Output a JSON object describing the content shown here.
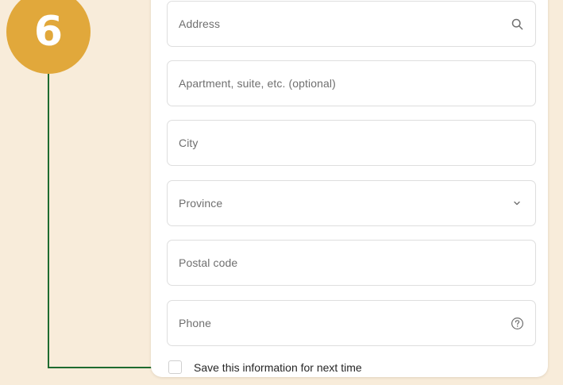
{
  "step_badge": {
    "number": "6",
    "color": "#e1a83b"
  },
  "connector_color": "#1e6b2f",
  "form": {
    "address": {
      "placeholder": "Address",
      "icon": "search-icon"
    },
    "apartment": {
      "placeholder": "Apartment, suite, etc. (optional)"
    },
    "city": {
      "placeholder": "City"
    },
    "province": {
      "placeholder": "Province",
      "icon": "chevron-down-icon"
    },
    "postal_code": {
      "placeholder": "Postal code"
    },
    "phone": {
      "placeholder": "Phone",
      "icon": "help-circle-icon"
    },
    "save_info": {
      "label": "Save this information for next time",
      "checked": false
    }
  }
}
